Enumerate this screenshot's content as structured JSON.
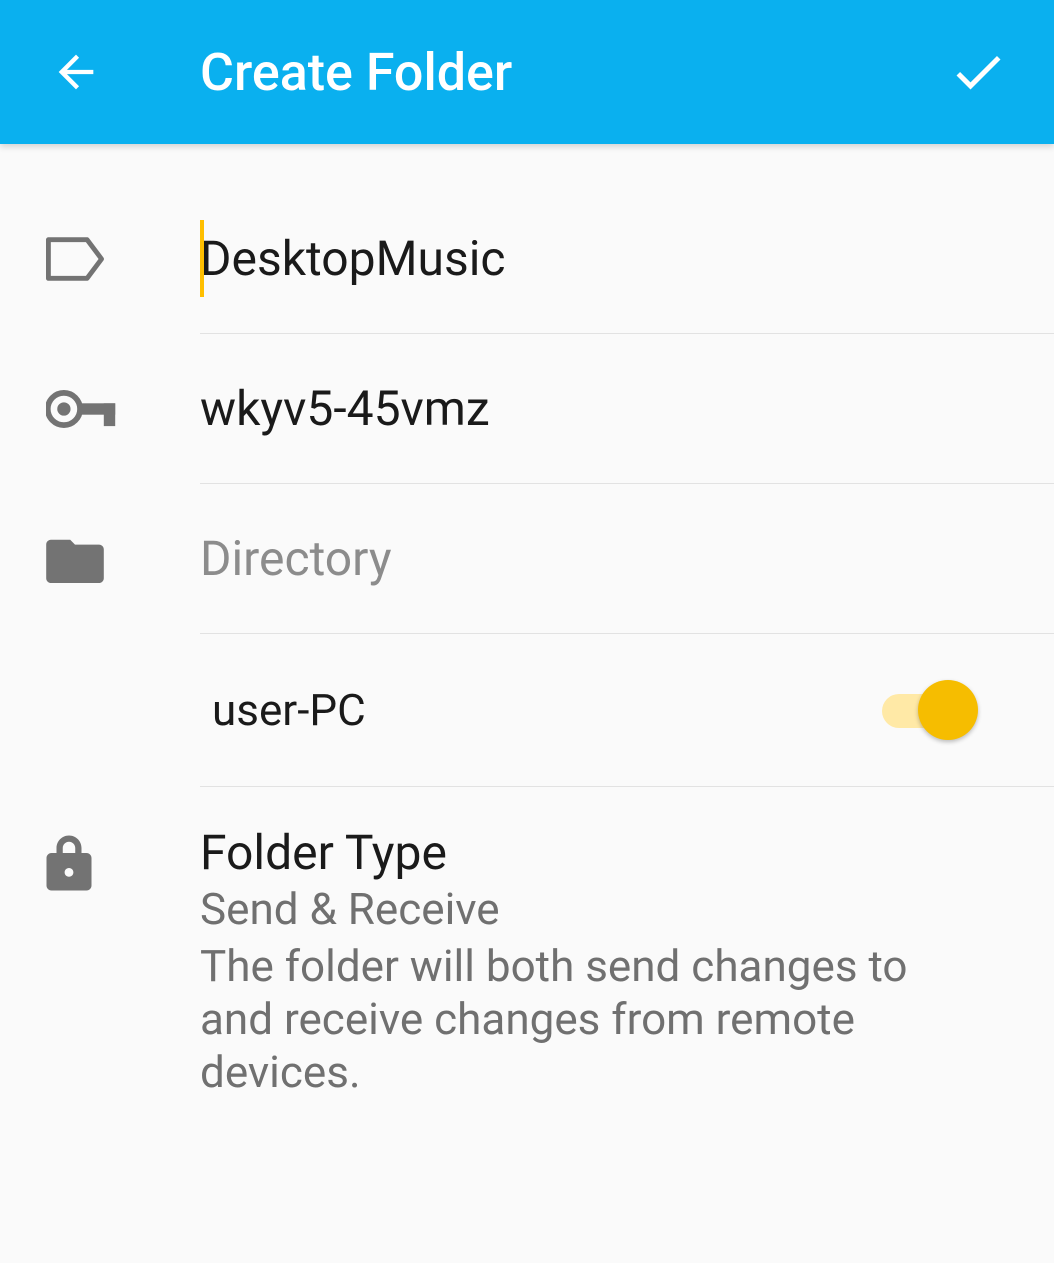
{
  "app_bar": {
    "title": "Create Folder"
  },
  "fields": {
    "label_value": "DesktopMusic",
    "id_value": "wkyv5-45vmz",
    "directory_placeholder": "Directory"
  },
  "device": {
    "name": "user-PC",
    "enabled": true
  },
  "folder_type": {
    "title": "Folder Type",
    "mode": "Send & Receive",
    "description": "The folder will both send changes to and receive changes from remote devices."
  }
}
